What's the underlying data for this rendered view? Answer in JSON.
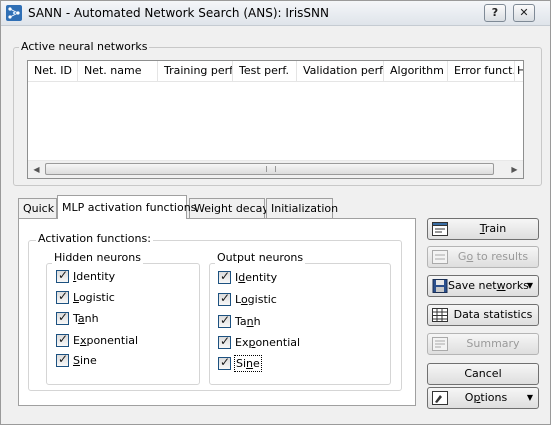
{
  "window": {
    "title": "SANN - Automated Network Search (ANS): IrisSNN",
    "help_glyph": "?",
    "close_glyph": "✕"
  },
  "networks_group": {
    "label": "Active neural networks",
    "columns": [
      "Net. ID",
      "Net. name",
      "Training perf.",
      "Test perf.",
      "Validation perf.",
      "Algorithm",
      "Error funct.",
      "H"
    ],
    "rows": []
  },
  "scrollbar": {
    "left_arrow": "◀",
    "right_arrow": "▶"
  },
  "tabs": [
    {
      "label": "Quick",
      "active": false
    },
    {
      "label": "MLP activation functions",
      "active": true
    },
    {
      "label": "Weight decay",
      "active": false
    },
    {
      "label": "Initialization",
      "active": false
    }
  ],
  "activation": {
    "group_label": "Activation functions:",
    "hidden": {
      "label": "Hidden neurons",
      "items": [
        {
          "pre": "",
          "key": "I",
          "post": "dentity",
          "checked": true
        },
        {
          "pre": "",
          "key": "L",
          "post": "ogistic",
          "checked": true
        },
        {
          "pre": "T",
          "key": "a",
          "post": "nh",
          "checked": true
        },
        {
          "pre": "E",
          "key": "x",
          "post": "ponential",
          "checked": true
        },
        {
          "pre": "",
          "key": "S",
          "post": "ine",
          "checked": true
        }
      ]
    },
    "output": {
      "label": "Output neurons",
      "items": [
        {
          "pre": "I",
          "key": "d",
          "post": "entity",
          "checked": true
        },
        {
          "pre": "L",
          "key": "o",
          "post": "gistic",
          "checked": true
        },
        {
          "pre": "Ta",
          "key": "n",
          "post": "h",
          "checked": true
        },
        {
          "pre": "Ex",
          "key": "p",
          "post": "onential",
          "checked": true
        },
        {
          "pre": "Si",
          "key": "n",
          "post": "e",
          "checked": true
        }
      ]
    }
  },
  "buttons": {
    "train": {
      "pre": "",
      "key": "T",
      "post": "rain"
    },
    "go_to_results": {
      "pre": "G",
      "key": "o",
      "post": " to results"
    },
    "save_networks": {
      "pre": "Save net",
      "key": "w",
      "post": "orks"
    },
    "data_statistics": {
      "pre": "Data statistics",
      "key": "",
      "post": ""
    },
    "summary": {
      "pre": "Summary",
      "key": "",
      "post": ""
    },
    "cancel": {
      "pre": "Cancel",
      "key": "",
      "post": ""
    },
    "options": {
      "pre": "O",
      "key": "p",
      "post": "tions"
    }
  },
  "icons": {
    "app": "network-icon",
    "train": "train-icon",
    "results": "results-icon",
    "save": "floppy-disk-icon",
    "statistics": "table-icon",
    "summary": "summary-icon",
    "options": "options-icon"
  },
  "colors": {
    "window_bg": "#f0f0f0",
    "checkbox_border": "#1c5180",
    "disabled_text": "#9a9a9a"
  }
}
